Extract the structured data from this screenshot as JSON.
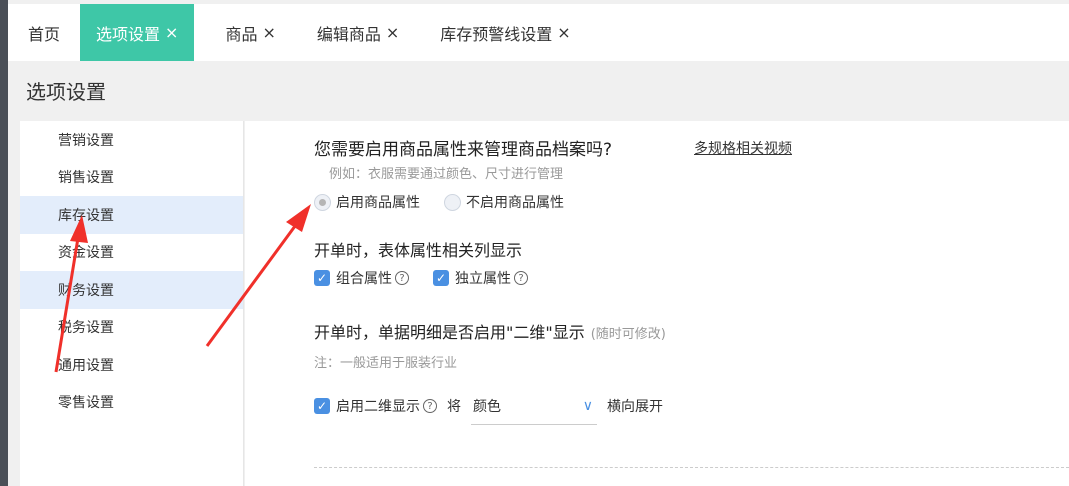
{
  "tabs": [
    {
      "label": "首页",
      "closable": false,
      "active": false
    },
    {
      "label": "选项设置",
      "closable": true,
      "active": true
    },
    {
      "label": "商品",
      "closable": true,
      "active": false
    },
    {
      "label": "编辑商品",
      "closable": true,
      "active": false
    },
    {
      "label": "库存预警线设置",
      "closable": true,
      "active": false
    }
  ],
  "close_glyph": "×",
  "page_title": "选项设置",
  "sidebar": {
    "items": [
      {
        "label": "营销设置"
      },
      {
        "label": "销售设置"
      },
      {
        "label": "库存设置"
      },
      {
        "label": "资金设置"
      },
      {
        "label": "财务设置"
      },
      {
        "label": "税务设置"
      },
      {
        "label": "通用设置"
      },
      {
        "label": "零售设置"
      }
    ]
  },
  "main": {
    "question": "您需要启用商品属性来管理商品档案吗?",
    "video_link": "多规格相关视频",
    "hint": "例如：衣服需要通过颜色、尺寸进行管理",
    "radio_enable": "启用商品属性",
    "radio_disable": "不启用商品属性",
    "section1_title": "开单时，表体属性相关列显示",
    "cb_combined": "组合属性",
    "cb_independent": "独立属性",
    "section2_title": "开单时，单据明细是否启用\"二维\"显示",
    "section2_sub": "(随时可修改)",
    "note": "注：一般适用于服装行业",
    "cb_2d": "启用二维显示",
    "prefix_jiang": "将",
    "select_value": "颜色",
    "suffix_expand": "横向展开",
    "help_glyph": "?",
    "check_glyph": "✓"
  },
  "colors": {
    "active_tab": "#3ec7a7",
    "checkbox": "#4a90e2",
    "sidebar_highlight": "#e3edfb",
    "arrow": "#f0302a"
  }
}
